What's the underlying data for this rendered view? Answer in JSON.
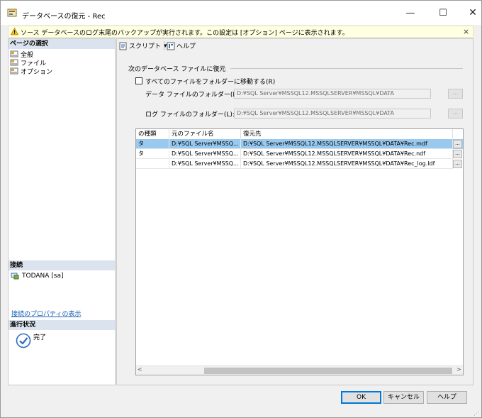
{
  "window": {
    "title": "データベースの復元 - Rec",
    "minimize_glyph": "—",
    "maximize_glyph": "☐",
    "close_glyph": "✕"
  },
  "banner": {
    "icon": "warning-icon",
    "text": "ソース データベースのログ末尾のバックアップが実行されます。この設定は [オプション] ページに表示されます。",
    "close_glyph": "×"
  },
  "left_pane": {
    "page_select_header": "ページの選択",
    "pages": [
      {
        "label": "全般",
        "icon": "page-icon"
      },
      {
        "label": "ファイル",
        "icon": "page-icon"
      },
      {
        "label": "オプション",
        "icon": "page-icon"
      }
    ],
    "connection_header": "接続",
    "connection_item": "TODANA [sa]",
    "connection_link": "接続のプロパティの表示",
    "progress_header": "進行状況",
    "progress_status": "完了"
  },
  "toolbar": {
    "script_label": "スクリプト",
    "script_arrow": "▾",
    "help_label": "ヘルプ"
  },
  "main": {
    "group_title": "次のデータベース ファイルに復元",
    "move_all_label": "すべてのファイルをフォルダーに移動する(R)",
    "data_folder_label": "データ ファイルのフォルダー(D):",
    "data_folder_value": "D:¥SQL Server¥MSSQL12.MSSQLSERVER¥MSSQL¥DATA",
    "log_folder_label": "ログ ファイルのフォルダー(L):",
    "log_folder_value": "D:¥SQL Server¥MSSQL12.MSSQLSERVER¥MSSQL¥DATA",
    "browse_label": "..."
  },
  "grid": {
    "columns": [
      "の種類",
      "元のファイル名",
      "復元先"
    ],
    "rows": [
      {
        "type": "タ",
        "original": "D:¥SQL Server¥MSSQ...",
        "restore_to": "D:¥SQL Server¥MSSQL12.MSSQLSERVER¥MSSQL¥DATA¥Rec.mdf",
        "btn": "..."
      },
      {
        "type": "タ",
        "original": "D:¥SQL Server¥MSSQ...",
        "restore_to": "D:¥SQL Server¥MSSQL12.MSSQLSERVER¥MSSQL¥DATA¥Rec.ndf",
        "btn": "..."
      },
      {
        "type": "",
        "original": "D:¥SQL Server¥MSSQ...",
        "restore_to": "D:¥SQL Server¥MSSQL12.MSSQLSERVER¥MSSQL¥DATA¥Rec_log.ldf",
        "btn": "..."
      }
    ],
    "scroll_left": "<",
    "scroll_right": ">"
  },
  "footer": {
    "ok_label": "OK",
    "cancel_label": "キャンセル",
    "help_label": "ヘルプ"
  }
}
